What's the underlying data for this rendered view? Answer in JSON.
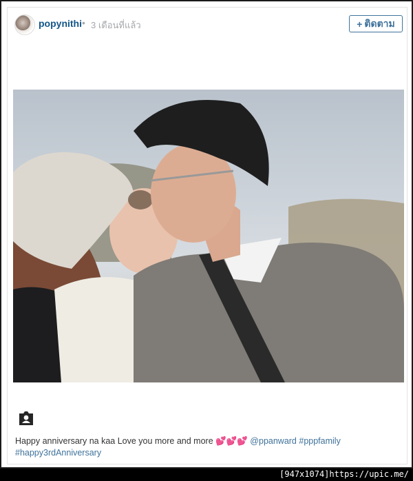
{
  "post": {
    "username": "popynithi",
    "dot": "•",
    "time_ago": "3 เดือนที่แล้ว",
    "follow_label": "ติดตาม",
    "follow_plus": "+"
  },
  "caption": {
    "text": "Happy anniversary na kaa Love you more and more 💕💕💕 ",
    "mention": "@ppanward",
    "hashtag1": "#pppfamily",
    "hashtag2": "#happy3rdAnniversary"
  },
  "watermark": "[947x1074]https://upic.me/",
  "colors": {
    "link": "#3f729b",
    "username": "#125688",
    "meta": "#a5a7aa"
  },
  "icons": {
    "tag": "person-tag-icon"
  }
}
